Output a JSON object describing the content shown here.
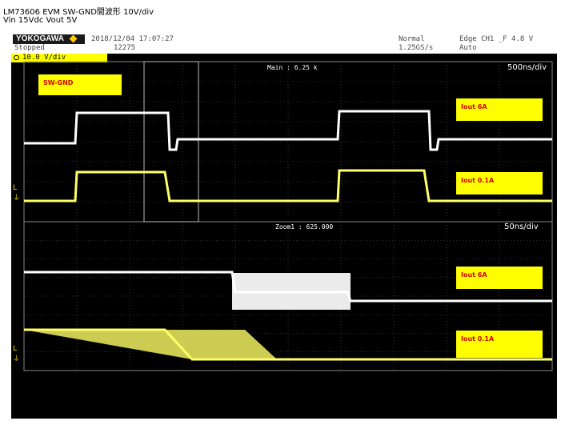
{
  "caption": {
    "line1": "LM73606 EVM SW-GND間波形  10V/div",
    "line2": "Vin 15Vdc Vout 5V"
  },
  "header": {
    "brand": "YOKOGAWA",
    "status": "Stopped",
    "datetime": "2018/12/04 17:07:27",
    "count": "12275",
    "mode": "Normal",
    "rate": "1.25GS/s",
    "trigger": "Edge CH1 _F 4.8 V",
    "trigger_mode": "Auto",
    "channel": "10.0 V/div"
  },
  "upper": {
    "label": "Main : 6.25 k",
    "timebase": "500ns/div",
    "tags": {
      "sw_gnd": "SW-GND",
      "iout_high": "Iout 6A",
      "iout_low": "Iout 0.1A"
    }
  },
  "lower": {
    "label": "Zoom1 : 625.000",
    "timebase": "50ns/div",
    "tags": {
      "iout_high": "Iout 6A",
      "iout_low": "Iout 0.1A"
    }
  },
  "colors": {
    "trace_white": "#ffffff",
    "trace_yellow": "#ffff66",
    "label_bg": "#ffff00",
    "label_text": "#d40000",
    "grid": "#5a5a5a"
  }
}
